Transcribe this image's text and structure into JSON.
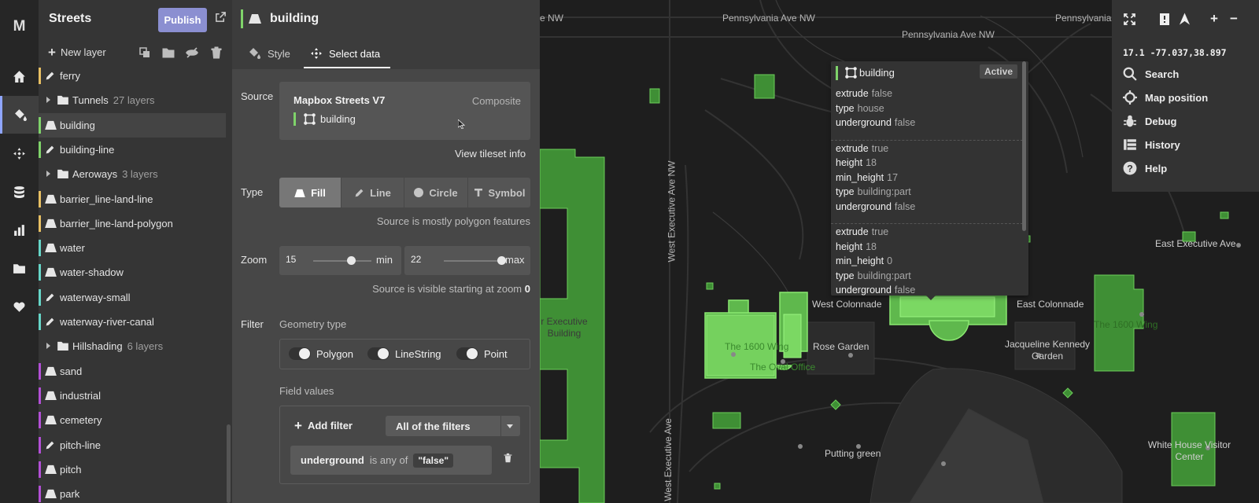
{
  "rail": {
    "logo": "M",
    "icons": [
      "home-icon",
      "paint-bucket-icon",
      "select-data-icon",
      "database-icon",
      "chart-icon",
      "folder-icon",
      "heart-icon"
    ]
  },
  "layers_panel": {
    "title": "Streets",
    "publish_label": "Publish",
    "new_layer_label": "New layer",
    "rows": [
      {
        "name": "ferry",
        "type": "line",
        "color": "#e8c063"
      },
      {
        "name": "Tunnels",
        "count": "27 layers",
        "type": "folder"
      },
      {
        "name": "building",
        "type": "fill",
        "color": "#7fd36a",
        "selected": true
      },
      {
        "name": "building-line",
        "type": "line",
        "color": "#7fd36a"
      },
      {
        "name": "Aeroways",
        "count": "3 layers",
        "type": "folder"
      },
      {
        "name": "barrier_line-land-line",
        "type": "fill",
        "color": "#e8c063"
      },
      {
        "name": "barrier_line-land-polygon",
        "type": "fill",
        "color": "#e8c063"
      },
      {
        "name": "water",
        "type": "fill",
        "color": "#66d6c8"
      },
      {
        "name": "water-shadow",
        "type": "fill",
        "color": "#66d6c8"
      },
      {
        "name": "waterway-small",
        "type": "line",
        "color": "#66d6c8"
      },
      {
        "name": "waterway-river-canal",
        "type": "line",
        "color": "#66d6c8"
      },
      {
        "name": "Hillshading",
        "count": "6 layers",
        "type": "folder"
      },
      {
        "name": "sand",
        "type": "fill",
        "color": "#b34fd6"
      },
      {
        "name": "industrial",
        "type": "fill",
        "color": "#b34fd6"
      },
      {
        "name": "cemetery",
        "type": "fill",
        "color": "#b34fd6"
      },
      {
        "name": "pitch-line",
        "type": "line",
        "color": "#b34fd6"
      },
      {
        "name": "pitch",
        "type": "fill",
        "color": "#b34fd6"
      },
      {
        "name": "park",
        "type": "fill",
        "color": "#b34fd6"
      }
    ]
  },
  "editor": {
    "layer_name": "building",
    "tabs": {
      "style": "Style",
      "select_data": "Select data"
    },
    "source": {
      "label": "Source",
      "name": "Mapbox Streets V7",
      "kind": "Composite",
      "layer": "building",
      "view_info": "View tileset info"
    },
    "type": {
      "label": "Type",
      "options": [
        "Fill",
        "Line",
        "Circle",
        "Symbol"
      ],
      "active": "Fill",
      "note": "Source is mostly polygon features"
    },
    "zoom": {
      "label": "Zoom",
      "min": "15",
      "min_label": "min",
      "max": "22",
      "max_label": "max",
      "min_fraction": 0.65,
      "max_fraction": 1.0,
      "note_prefix": "Source is visible starting at zoom",
      "note_value": "0"
    },
    "filter": {
      "label": "Filter",
      "geometry_label": "Geometry type",
      "geometry": [
        "Polygon",
        "LineString",
        "Point"
      ],
      "field_values_label": "Field values",
      "add_filter": "Add filter",
      "mode": "All of the filters",
      "rule": {
        "key": "underground",
        "op": "is any of",
        "value": "\"false\""
      }
    }
  },
  "map": {
    "labels": {
      "pa1": "Pennsylvania Ave NW",
      "pa2": "Pennsylvania Ave NW",
      "nw1": "e NW",
      "nw2": "Pennsylvania Ave NW",
      "west_exec1": "West Executive Ave NW",
      "west_exec2": "West Executive Ave",
      "west_colonnade": "West Colonnade",
      "east_colonnade": "East Colonnade",
      "rose_garden": "Rose Garden",
      "jk_garden": "Jacqueline Kennedy Garden",
      "putting_green": "Putting green",
      "east_exec": "East Executive Ave",
      "wh_visitor": "White House Visitor Center",
      "eeob": "r Executive Building",
      "b1600": "The 1600 Wing",
      "oval": "The Oval Office",
      "w1600": "The 1600 Wing"
    },
    "popup": {
      "layer": "building",
      "status": "Active",
      "groups": [
        [
          [
            "extrude",
            "false"
          ],
          [
            "type",
            "house"
          ],
          [
            "underground",
            "false"
          ]
        ],
        [
          [
            "extrude",
            "true"
          ],
          [
            "height",
            "18"
          ],
          [
            "min_height",
            "17"
          ],
          [
            "type",
            "building:part"
          ],
          [
            "underground",
            "false"
          ]
        ],
        [
          [
            "extrude",
            "true"
          ],
          [
            "height",
            "18"
          ],
          [
            "min_height",
            "0"
          ],
          [
            "type",
            "building:part"
          ],
          [
            "underground",
            "false"
          ]
        ]
      ]
    },
    "controls": {
      "coords": "17.1 -77.037,38.897",
      "menu": [
        "Search",
        "Map position",
        "Debug",
        "History",
        "Help"
      ]
    }
  }
}
